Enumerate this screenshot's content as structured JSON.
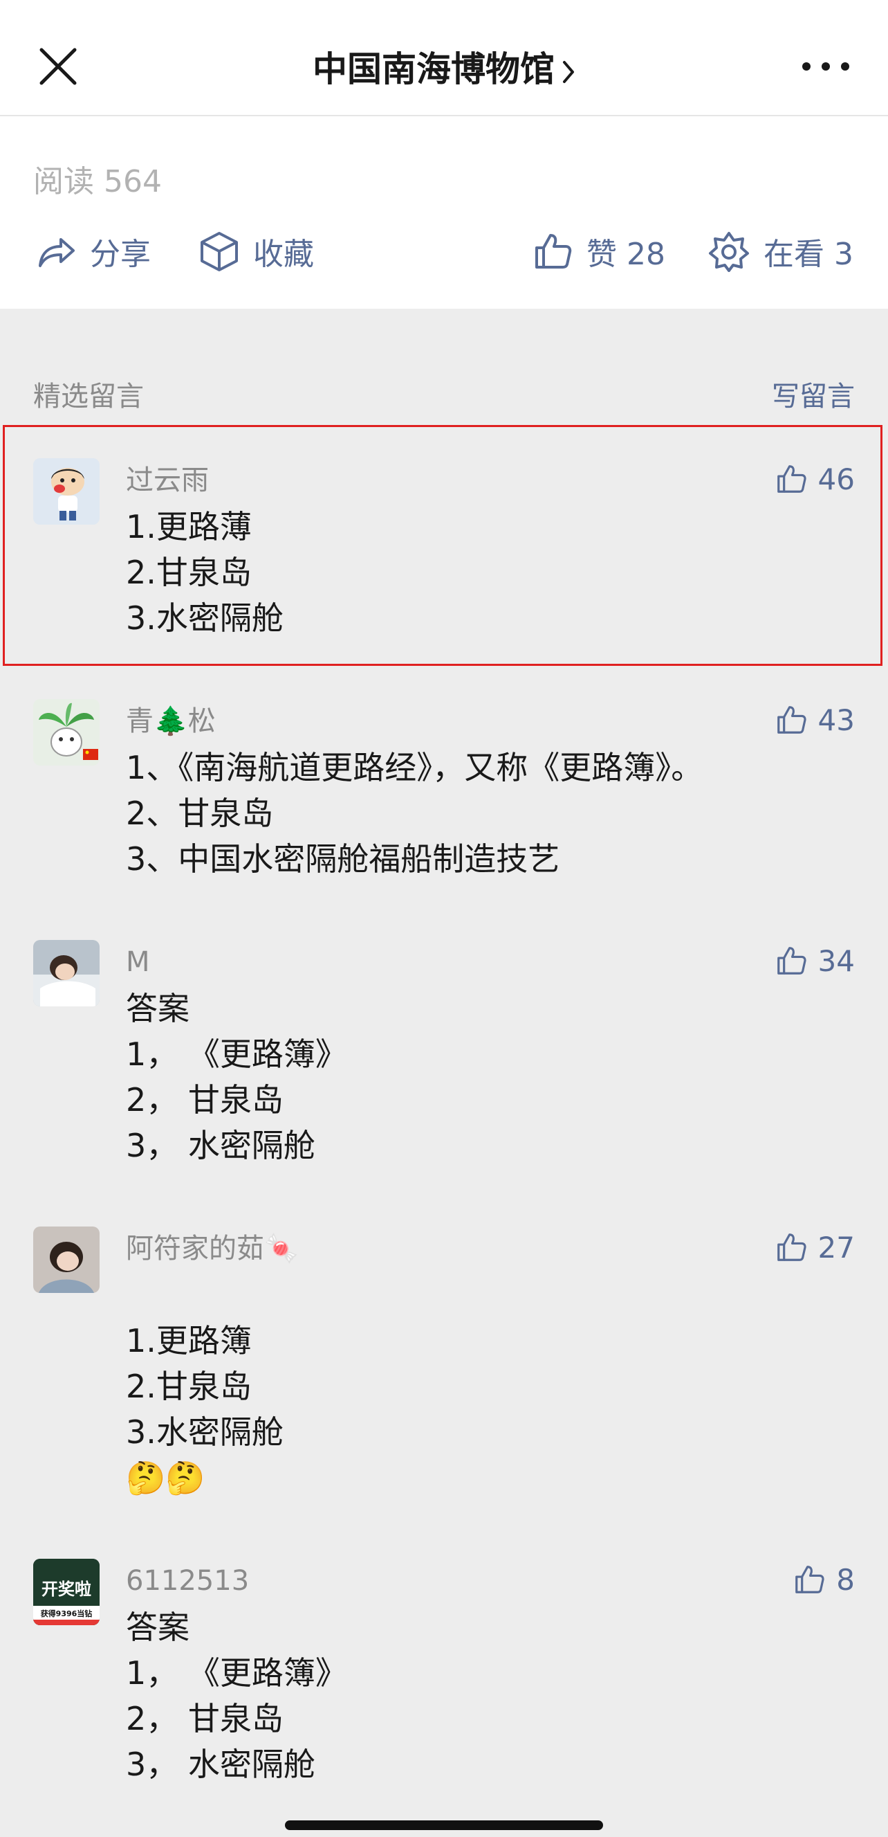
{
  "header": {
    "title": "中国南海博物馆"
  },
  "stats": {
    "read_label": "阅读 564"
  },
  "actions": {
    "share": "分享",
    "favorite": "收藏",
    "like": "赞 28",
    "watching": "在看 3"
  },
  "comments_section": {
    "title": "精选留言",
    "write": "写留言"
  },
  "comments": [
    {
      "nick": "过云雨",
      "likes": "46",
      "lines": [
        "1.更路薄",
        "2.甘泉岛",
        "3.水密隔舱"
      ]
    },
    {
      "nick": "青🌲松",
      "likes": "43",
      "lines": [
        "1、《南海航道更路经》，又称《更路簿》。",
        "2、甘泉岛",
        "3、中国水密隔舱福船制造技艺"
      ]
    },
    {
      "nick": "M",
      "likes": "34",
      "lines": [
        "答案",
        "1， 《更路簿》",
        "2， 甘泉岛",
        "3， 水密隔舱"
      ]
    },
    {
      "nick": "阿符家的茹🍬",
      "likes": "27",
      "lines": [
        "1.更路簿",
        "2.甘泉岛",
        "3.水密隔舱",
        "🤔🤔"
      ]
    },
    {
      "nick": "6112513",
      "likes": "8",
      "lines": [
        "答案",
        "1， 《更路簿》",
        "2， 甘泉岛",
        "3， 水密隔舱"
      ]
    }
  ],
  "avatar_5_text": {
    "top": "开奖啦",
    "bottom": "获得9396当钻"
  }
}
